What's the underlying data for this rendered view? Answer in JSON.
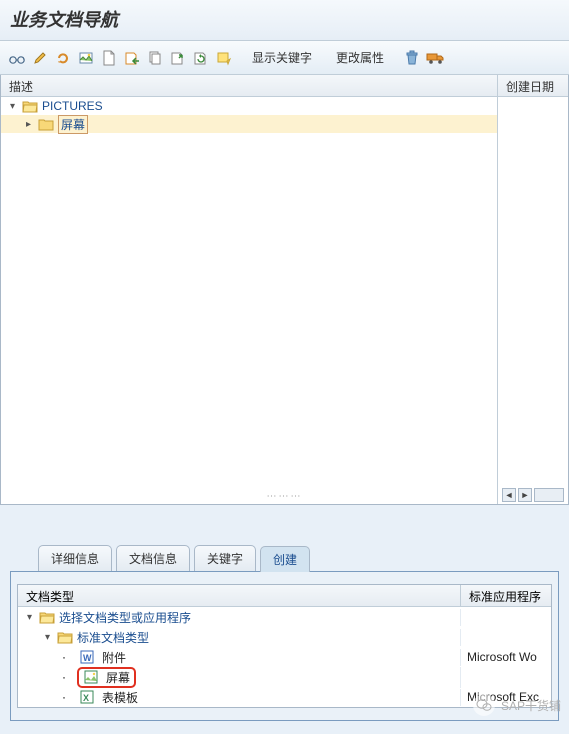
{
  "header": {
    "title": "业务文档导航"
  },
  "toolbar": {
    "show_keywords": "显示关键字",
    "change_attributes": "更改属性"
  },
  "tree": {
    "columns": {
      "desc": "描述",
      "created": "创建日期"
    },
    "root": {
      "label": "PICTURES",
      "expanded": true
    },
    "child": {
      "label": "屏幕"
    }
  },
  "tabs": {
    "detail": "详细信息",
    "doc_info": "文档信息",
    "keywords": "关键字",
    "create": "创建"
  },
  "create_panel": {
    "columns": {
      "type": "文档类型",
      "app": "标准应用程序"
    },
    "root": {
      "label": "选择文档类型或应用程序"
    },
    "std": {
      "label": "标准文档类型"
    },
    "items": [
      {
        "label": "附件",
        "app": "Microsoft Wo",
        "doc_icon": "word"
      },
      {
        "label": "屏幕",
        "app": "",
        "doc_icon": "image",
        "highlight": true
      },
      {
        "label": "表模板",
        "app": "Microsoft Exc",
        "doc_icon": "excel"
      }
    ]
  },
  "watermark": {
    "text": "SAP干货铺"
  }
}
